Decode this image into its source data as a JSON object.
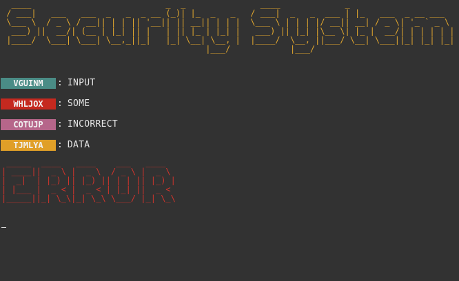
{
  "header": {
    "ascii_art": "  ____                           _  _               ____             _                   \n / ___|   ___   ___  _   _  _ __ (_)| |_  _   _   / ___|  _   _  ___ | |_   ___  _ __ ___  \n \\___ \\  / _ \\ / __|| | | || '__|| || __|| | | |  \\___ \\ | | | |/ __|| __| / _ \\| '_ ` _ \\ \n  ___) ||  __/| (__ | |_| || |   | || |_ | |_| |   ___) || |_| |\\__ \\| |_ |  __/| | | | | |\n |____/  \\___| \\___| \\__,_||_|   |_| \\__| \\__, |  |____/  \\__, ||___/ \\__| \\___||_| |_| |_|\n                                         |___/            |___/                          ",
    "title": "Security System"
  },
  "legend": [
    {
      "code": "VGUINM",
      "separator": ":",
      "word": "INPUT",
      "color": "#4a8c86"
    },
    {
      "code": "WHLJOX",
      "separator": ":",
      "word": "SOME",
      "color": "#c5291f"
    },
    {
      "code": "COTUJP",
      "separator": ":",
      "word": "INCORRECT",
      "color": "#b6668a"
    },
    {
      "code": "TJMLYA",
      "separator": ":",
      "word": "DATA",
      "color": "#e09f28"
    }
  ],
  "error": {
    "ascii_art": " _____  ____   ____    ___   ____  \n| ____||  _ \\ |  _ \\  / _ \\ |  _ \\ \n|  _|  | |_) || |_) || | | || |_) |\n| |___ |  _ < |  _ < | |_| ||  _ < \n|_____||_| \\_\\|_| \\_\\ \\___/ |_| \\_\\",
    "text": "ERROR"
  },
  "prompt": {
    "cursor": "_"
  }
}
